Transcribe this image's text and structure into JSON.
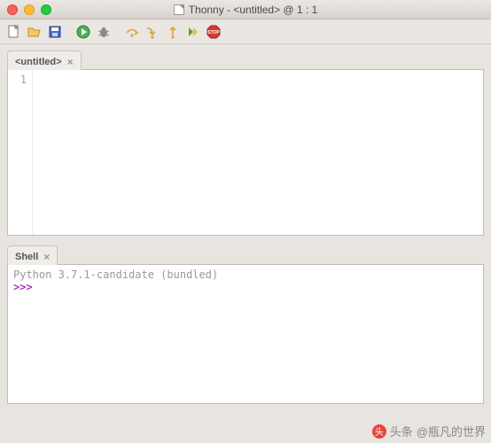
{
  "window": {
    "title": "Thonny - <untitled> @  1 : 1"
  },
  "toolbar": {
    "icons": [
      {
        "name": "new-file-icon"
      },
      {
        "name": "open-file-icon"
      },
      {
        "name": "save-icon"
      },
      {
        "name": "run-icon"
      },
      {
        "name": "debug-icon"
      },
      {
        "name": "step-over-icon"
      },
      {
        "name": "step-into-icon"
      },
      {
        "name": "step-out-icon"
      },
      {
        "name": "resume-icon"
      },
      {
        "name": "stop-icon"
      }
    ]
  },
  "editor": {
    "tab_label": "<untitled>",
    "line_numbers": [
      "1"
    ],
    "content": ""
  },
  "shell": {
    "tab_label": "Shell",
    "banner": "Python 3.7.1-candidate (bundled)",
    "prompt": ">>>"
  },
  "watermark": {
    "prefix": "头条",
    "handle": "@瓶凡的世界"
  }
}
